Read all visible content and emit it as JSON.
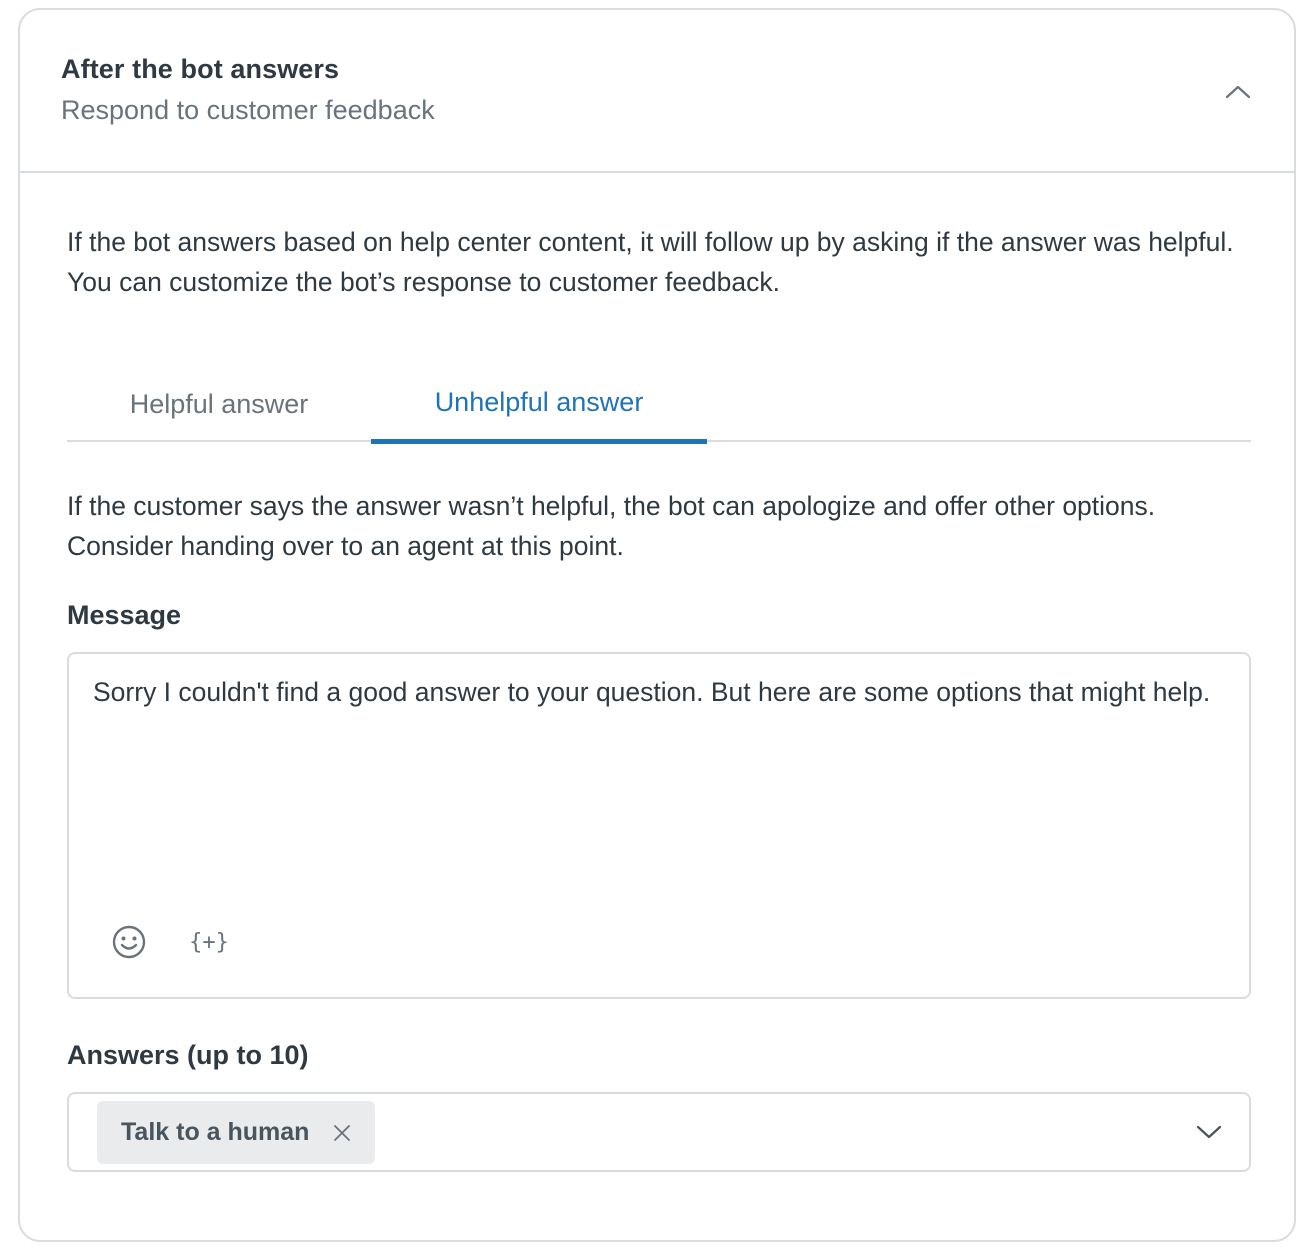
{
  "panel": {
    "title": "After the bot answers",
    "subtitle": "Respond to customer feedback",
    "collapse_icon": "chevron-up-icon"
  },
  "intro_text": "If the bot answers based on help center content, it will follow up by asking if the answer was helpful. You can customize the bot’s response to customer feedback.",
  "tabs": [
    {
      "label": "Helpful answer",
      "selected": false
    },
    {
      "label": "Unhelpful answer",
      "selected": true
    }
  ],
  "tab_description": "If the customer says the answer wasn’t helpful, the bot can apologize and offer other options. Consider handing over to an agent at this point.",
  "message": {
    "label": "Message",
    "value": "Sorry I couldn't find a good answer to your question. But here are some options that might help.",
    "toolbar": {
      "emoji_icon": "emoji-icon",
      "variable_label": "{+}"
    }
  },
  "answers": {
    "label": "Answers (up to 10)",
    "tags": [
      {
        "label": "Talk to a human"
      }
    ],
    "dropdown_icon": "chevron-down-icon"
  },
  "colors": {
    "accent": "#1f73b7",
    "text": "#2f3941",
    "muted": "#68737d",
    "border": "#d8dcde",
    "tag_bg": "#e9ebed"
  }
}
